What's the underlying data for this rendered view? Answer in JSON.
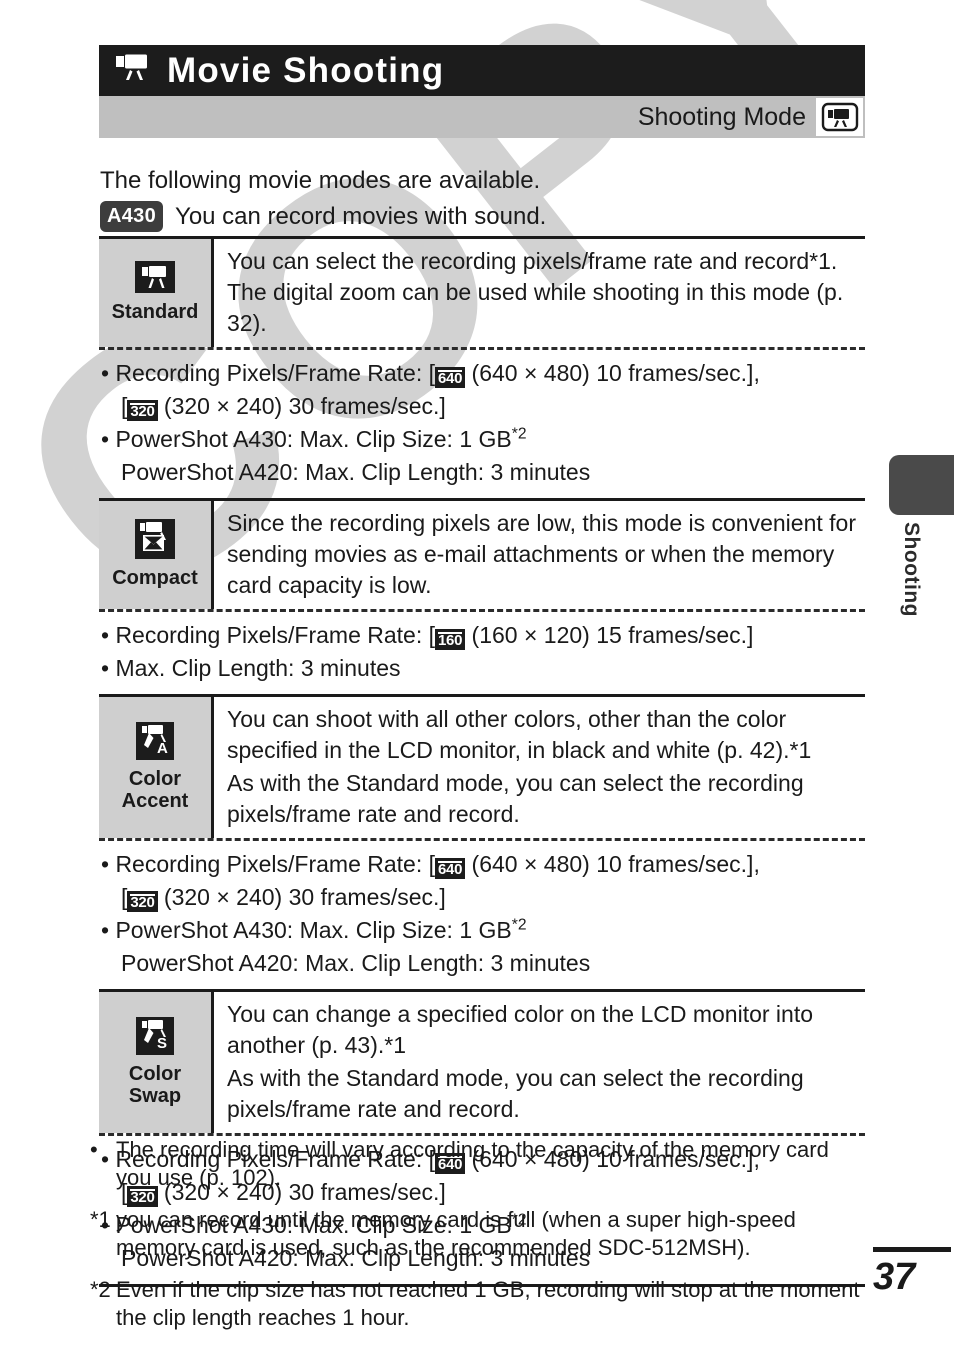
{
  "header": {
    "title": "Movie Shooting",
    "title_icon": "movie-camera-icon",
    "mode_label": "Shooting Mode",
    "mode_icon": "movie-camera-icon"
  },
  "intro": {
    "line1": "The following movie modes are available.",
    "badge": "A430",
    "line2": "You can record movies with sound."
  },
  "modes": [
    {
      "icon": "movie-camera-icon",
      "name": "Standard",
      "description": [
        "You can select the recording pixels/frame rate and record*1. The digital zoom can be used while shooting in this mode (p. 32)."
      ],
      "specs": [
        {
          "bullet": "• Recording Pixels/Frame Rate: [",
          "badge1": "640",
          "mid": " (640 × 480) 10 frames/sec.],",
          "cont_prefix": "[",
          "badge2": "320",
          "cont_suffix": " (320 × 240) 30 frames/sec.]"
        },
        {
          "bullet": "• PowerShot A430: Max. Clip Size: 1 GB",
          "sup": "*2",
          "cont": "PowerShot A420: Max. Clip Length: 3 minutes"
        }
      ]
    },
    {
      "icon": "movie-camera-email-icon",
      "name": "Compact",
      "description": [
        "Since the recording pixels are low, this mode is convenient for sending movies as e-mail attachments or when the memory card capacity is low."
      ],
      "specs": [
        {
          "bullet": "• Recording Pixels/Frame Rate: [",
          "badge1": "160",
          "mid": " (160 × 120) 15 frames/sec.]"
        },
        {
          "bullet": "• Max. Clip Length: 3 minutes"
        }
      ]
    },
    {
      "icon": "color-accent-icon",
      "name": "Color\nAccent",
      "name_line1": "Color",
      "name_line2": "Accent",
      "description": [
        "You can shoot with all other colors, other than the color specified in the LCD monitor, in black and white (p. 42).*1",
        "As with the Standard mode, you can select the recording pixels/frame rate and record."
      ],
      "specs": [
        {
          "bullet": "• Recording Pixels/Frame Rate: [",
          "badge1": "640",
          "mid": " (640 × 480) 10 frames/sec.],",
          "cont_prefix": "[",
          "badge2": "320",
          "cont_suffix": " (320 × 240) 30 frames/sec.]"
        },
        {
          "bullet": "• PowerShot A430: Max. Clip Size: 1 GB",
          "sup": "*2",
          "cont": "PowerShot A420: Max. Clip Length: 3 minutes"
        }
      ]
    },
    {
      "icon": "color-swap-icon",
      "name": "Color\nSwap",
      "name_line1": "Color",
      "name_line2": "Swap",
      "description": [
        "You can change a specified color on the LCD monitor into another (p. 43).*1",
        "As with the Standard mode, you can select the recording pixels/frame rate and record."
      ],
      "specs": [
        {
          "bullet": "• Recording Pixels/Frame Rate: [",
          "badge1": "640",
          "mid": " (640 × 480) 10 frames/sec.],",
          "cont_prefix": "[",
          "badge2": "320",
          "cont_suffix": " (320 × 240) 30 frames/sec.]"
        },
        {
          "bullet": "• PowerShot A430: Max. Clip Size: 1 GB",
          "sup": "*2",
          "cont": "PowerShot A420: Max. Clip Length: 3 minutes"
        }
      ]
    }
  ],
  "notes": [
    {
      "marker": "•",
      "text": "The recording time will vary according to the capacity of the memory card you use (p. 102)."
    },
    {
      "marker": "*1",
      "text": "you can record until the memory card is full (when a super high-speed memory card is used, such as the recommended SDC-512MSH)."
    },
    {
      "marker": "*2",
      "text": "Even if the clip size has not reached 1 GB, recording will stop at the moment the clip length reaches 1 hour."
    }
  ],
  "sidebar": {
    "tab_label": "Shooting"
  },
  "footer": {
    "page_number": "37"
  },
  "watermark": {
    "text": "COPY"
  },
  "colors": {
    "title_bar_bg": "#1c1c1c",
    "mode_band_bg": "#bfbfbf",
    "mode_cell_bg": "#cfcfcf",
    "side_tab_bg": "#4a4a4a",
    "watermark": "#d2d2d2",
    "text": "#1a1a1a"
  }
}
